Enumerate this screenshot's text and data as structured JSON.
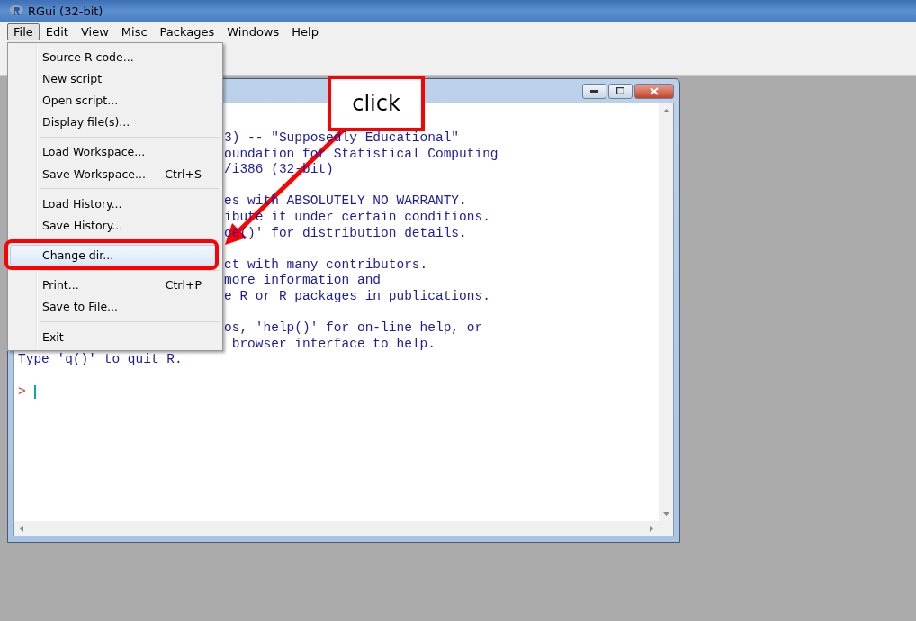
{
  "window": {
    "title": "RGui (32-bit)"
  },
  "menu_bar": [
    {
      "label": "File",
      "selected": true
    },
    {
      "label": "Edit",
      "selected": false
    },
    {
      "label": "View",
      "selected": false
    },
    {
      "label": "Misc",
      "selected": false
    },
    {
      "label": "Packages",
      "selected": false
    },
    {
      "label": "Windows",
      "selected": false
    },
    {
      "label": "Help",
      "selected": false
    }
  ],
  "file_menu": [
    {
      "kind": "item",
      "label": "Source R code...",
      "selected": false
    },
    {
      "kind": "item",
      "label": "New script",
      "selected": false
    },
    {
      "kind": "item",
      "label": "Open script...",
      "selected": false
    },
    {
      "kind": "item",
      "label": "Display file(s)...",
      "selected": false
    },
    {
      "kind": "separator"
    },
    {
      "kind": "item",
      "label": "Load Workspace...",
      "selected": false
    },
    {
      "kind": "item",
      "label": "Save Workspace...",
      "shortcut": "Ctrl+S",
      "selected": false
    },
    {
      "kind": "separator"
    },
    {
      "kind": "item",
      "label": "Load History...",
      "selected": false
    },
    {
      "kind": "item",
      "label": "Save History...",
      "selected": false
    },
    {
      "kind": "separator"
    },
    {
      "kind": "item",
      "label": "Change dir...",
      "selected": true
    },
    {
      "kind": "separator"
    },
    {
      "kind": "item",
      "label": "Print...",
      "shortcut": "Ctrl+P",
      "selected": false
    },
    {
      "kind": "item",
      "label": "Save to File...",
      "selected": false
    },
    {
      "kind": "separator"
    },
    {
      "kind": "item",
      "label": "Exit",
      "selected": false
    }
  ],
  "console": {
    "lines": [
      {
        "kind": "fragment",
        "text": "3) -- \"Supposedly Educational\""
      },
      {
        "kind": "fragment",
        "text": "oundation for Statistical Computing"
      },
      {
        "kind": "fragment",
        "text": "/i386 (32-bit)"
      },
      {
        "kind": "blank"
      },
      {
        "kind": "fragment",
        "text": "es with ABSOLUTELY NO WARRANTY."
      },
      {
        "kind": "fragment",
        "text": "ibute it under certain conditions."
      },
      {
        "kind": "fragment",
        "text": "ce()' for distribution details."
      },
      {
        "kind": "blank"
      },
      {
        "kind": "fragment",
        "text": "ct with many contributors."
      },
      {
        "kind": "fragment",
        "text": "more information and"
      },
      {
        "kind": "fragment",
        "text": "e R or R packages in publications."
      },
      {
        "kind": "blank"
      },
      {
        "kind": "fragment",
        "text": "os, 'help()' for on-line help, or"
      },
      {
        "kind": "fragment",
        "text": " browser interface to help."
      },
      {
        "kind": "line",
        "text": "Type 'q()' to quit R."
      },
      {
        "kind": "blank"
      },
      {
        "kind": "prompt",
        "text": ">"
      }
    ]
  },
  "annotation": {
    "callout": "click"
  }
}
